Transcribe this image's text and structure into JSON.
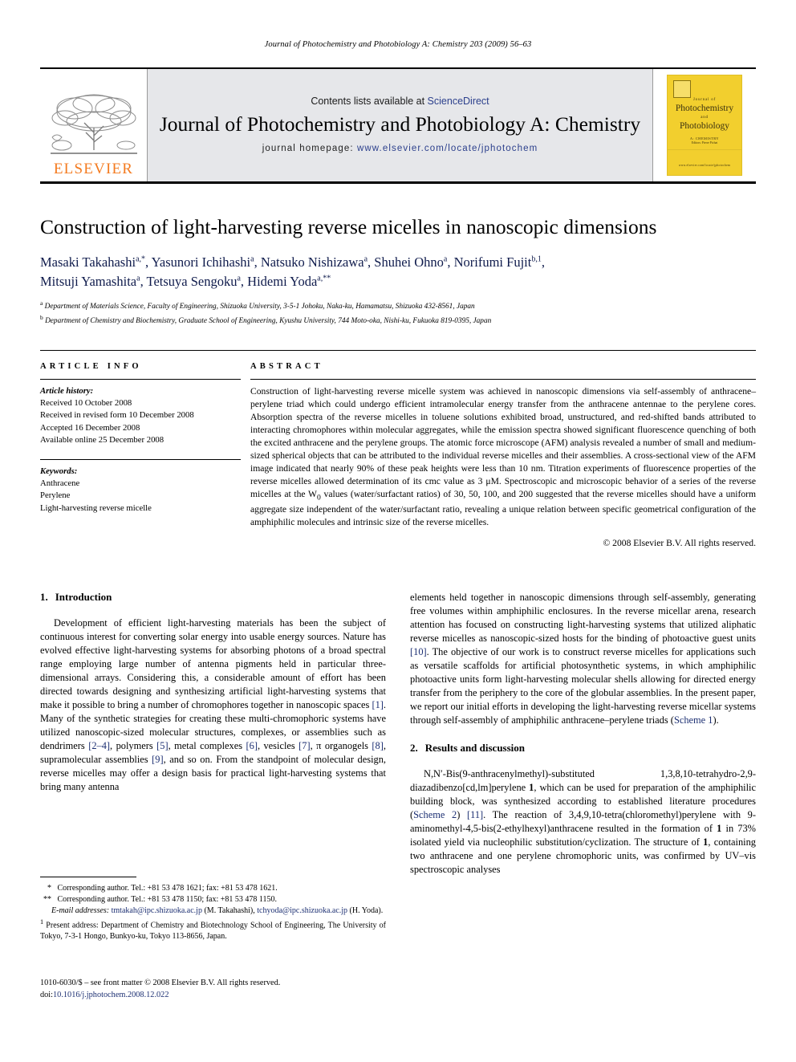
{
  "running_head": "Journal of Photochemistry and Photobiology A: Chemistry 203 (2009) 56–63",
  "masthead": {
    "publisher_logo_text": "ELSEVIER",
    "contents_prefix": "Contents lists available at ",
    "contents_link": "ScienceDirect",
    "journal_title": "Journal of Photochemistry and Photobiology A: Chemistry",
    "homepage_label": "journal homepage: ",
    "homepage_url": "www.elsevier.com/locate/jphotochem",
    "cover": {
      "line_journal": "Journal of",
      "line_title1": "Photochemistry",
      "line_and": "and",
      "line_title2": "Photobiology",
      "editors": "A: CHEMISTRY",
      "editors_sub": "Editors: Pierre Pichat",
      "url": "www.elsevier.com/locate/jphotochem"
    },
    "accent_orange": "#F47B20",
    "link_blue": "#2b3f8c",
    "band_gray": "#e6e7ea"
  },
  "article": {
    "title": "Construction of light-harvesting reverse micelles in nanoscopic dimensions",
    "authors_line1": "Masaki Takahashi<sup>a,*</sup>, Yasunori Ichihashi<sup>a</sup>, Natsuko Nishizawa<sup>a</sup>, Shuhei Ohno<sup>a</sup>, Norifumi Fujit<sup>b,1</sup>,",
    "authors_line2": "Mitsuji Yamashita<sup>a</sup>, Tetsuya Sengoku<sup>a</sup>, Hidemi Yoda<sup>a,**</sup>",
    "affiliation_a": "<sup>a</sup> Department of Materials Science, Faculty of Engineering, Shizuoka University, 3-5-1 Johoku, Naka-ku, Hamamatsu, Shizuoka 432-8561, Japan",
    "affiliation_b": "<sup>b</sup> Department of Chemistry and Biochemistry, Graduate School of Engineering, Kyushu University, 744 Moto-oka, Nishi-ku, Fukuoka 819-0395, Japan"
  },
  "article_info": {
    "heading": "ARTICLE INFO",
    "history_label": "Article history:",
    "history": [
      "Received 10 October 2008",
      "Received in revised form 10 December 2008",
      "Accepted 16 December 2008",
      "Available online 25 December 2008"
    ],
    "keywords_label": "Keywords:",
    "keywords": [
      "Anthracene",
      "Perylene",
      "Light-harvesting reverse micelle"
    ]
  },
  "abstract": {
    "heading": "ABSTRACT",
    "text": "Construction of light-harvesting reverse micelle system was achieved in nanoscopic dimensions via self-assembly of anthracene–perylene triad which could undergo efficient intramolecular energy transfer from the anthracene antennae to the perylene cores. Absorption spectra of the reverse micelles in toluene solutions exhibited broad, unstructured, and red-shifted bands attributed to interacting chromophores within molecular aggregates, while the emission spectra showed significant fluorescence quenching of both the excited anthracene and the perylene groups. The atomic force microscope (AFM) analysis revealed a number of small and medium-sized spherical objects that can be attributed to the individual reverse micelles and their assemblies. A cross-sectional view of the AFM image indicated that nearly 90% of these peak heights were less than 10 nm. Titration experiments of fluorescence properties of the reverse micelles allowed determination of its cmc value as 3 μM. Spectroscopic and microscopic behavior of a series of the reverse micelles at the W<sub>0</sub> values (water/surfactant ratios) of 30, 50, 100, and 200 suggested that the reverse micelles should have a uniform aggregate size independent of the water/surfactant ratio, revealing a unique relation between specific geometrical configuration of the amphiphilic molecules and intrinsic size of the reverse micelles.",
    "copyright": "© 2008 Elsevier B.V. All rights reserved."
  },
  "sections": {
    "intro_heading_num": "1.",
    "intro_heading": "Introduction",
    "intro_p1": "Development of efficient light-harvesting materials has been the subject of continuous interest for converting solar energy into usable energy sources. Nature has evolved effective light-harvesting systems for absorbing photons of a broad spectral range employing large number of antenna pigments held in particular three-dimensional arrays. Considering this, a considerable amount of effort has been directed towards designing and synthesizing artificial light-harvesting systems that make it possible to bring a number of chromophores together in nanoscopic spaces <a class=\"ref\">[1]</a>. Many of the synthetic strategies for creating these multi-chromophoric systems have utilized nanoscopic-sized molecular structures, complexes, or assemblies such as dendrimers <a class=\"ref\">[2–4]</a>, polymers <a class=\"ref\">[5]</a>, metal complexes <a class=\"ref\">[6]</a>, vesicles <a class=\"ref\">[7]</a>, π organogels <a class=\"ref\">[8]</a>, supramolecular assemblies <a class=\"ref\">[9]</a>, and so on. From the standpoint of molecular design, reverse micelles may offer a design basis for practical light-harvesting systems that bring many antenna",
    "intro_p2": "elements held together in nanoscopic dimensions through self-assembly, generating free volumes within amphiphilic enclosures. In the reverse micellar arena, research attention has focused on constructing light-harvesting systems that utilized aliphatic reverse micelles as nanoscopic-sized hosts for the binding of photoactive guest units <a class=\"ref\">[10]</a>. The objective of our work is to construct reverse micelles for applications such as versatile scaffolds for artificial photosynthetic systems, in which amphiphilic photoactive units form light-harvesting molecular shells allowing for directed energy transfer from the periphery to the core of the globular assemblies. In the present paper, we report our initial efforts in developing the light-harvesting reverse micellar systems through self-assembly of amphiphilic anthracene–perylene triads (<a class=\"lnk\">Scheme 1</a>).",
    "results_heading_num": "2.",
    "results_heading": "Results and discussion",
    "results_p1": "N,N′-Bis(9-anthracenylmethyl)-substituted 1,3,8,10-tetrahydro-2,9-diazadibenzo[cd,lm]perylene <b>1</b>, which can be used for preparation of the amphiphilic building block, was synthesized according to established literature procedures (<a class=\"lnk\">Scheme 2</a>) <a class=\"ref\">[11]</a>. The reaction of 3,4,9,10-tetra(chloromethyl)perylene with 9-aminomethyl-4,5-bis(2-ethylhexyl)anthracene resulted in the formation of <b>1</b> in 73% isolated yield via nucleophilic substitution/cyclization. The structure of <b>1</b>, containing two anthracene and one perylene chromophoric units, was confirmed by UV–vis spectroscopic analyses"
  },
  "footnotes": {
    "corresponding_1": "<span class=\"star\">*</span> Corresponding author. Tel.: +81 53 478 1621; fax: +81 53 478 1621.",
    "corresponding_2": "<span class=\"star\">**</span> Corresponding author. Tel.: +81 53 478 1150; fax: +81 53 478 1150.",
    "emails": "<span class=\"ital\">E-mail addresses:</span> <span class=\"mail\">tmtakah@ipc.shizuoka.ac.jp</span> (M. Takahashi), <span class=\"mail\">tchyoda@ipc.shizuoka.ac.jp</span> (H. Yoda).",
    "present_address": "<sup>1</sup> Present address: Department of Chemistry and Biotechnology School of Engineering, The University of Tokyo, 7-3-1 Hongo, Bunkyo-ku, Tokyo 113-8656, Japan."
  },
  "imprint": {
    "line1": "1010-6030/$ – see front matter © 2008 Elsevier B.V. All rights reserved.",
    "doi_label": "doi:",
    "doi_value": "10.1016/j.jphotochem.2008.12.022"
  }
}
